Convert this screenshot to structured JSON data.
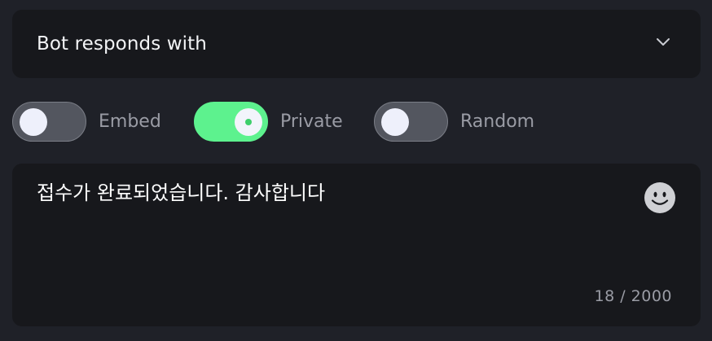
{
  "dropdown": {
    "label": "Bot responds with",
    "icon": "chevron-down-icon"
  },
  "toggles": [
    {
      "label": "Embed",
      "on": false
    },
    {
      "label": "Private",
      "on": true
    },
    {
      "label": "Random",
      "on": false
    }
  ],
  "message": {
    "text": "접수가 완료되었습니다. 감사합니다",
    "char_count": "18 / 2000",
    "emoji_icon": "smiley-icon"
  },
  "colors": {
    "background": "#1f2128",
    "panel": "#17181c",
    "toggle_on": "#5df28e",
    "toggle_off": "#53565f",
    "muted_text": "#9a9ca5"
  }
}
